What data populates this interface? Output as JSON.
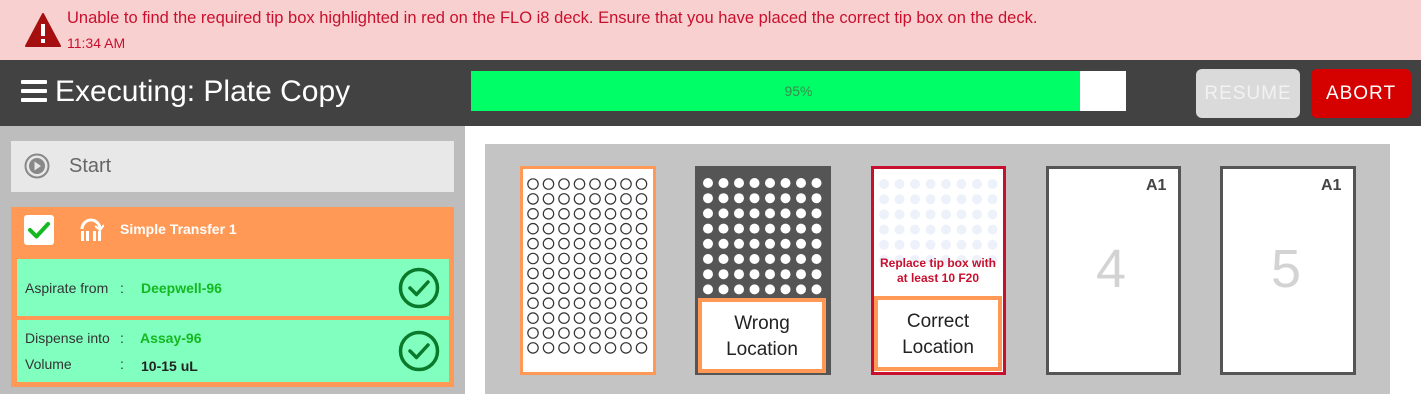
{
  "alert": {
    "message": "Unable to find the required tip box highlighted in red on the FLO i8 deck. Ensure that you have placed the correct tip box on the deck.",
    "time": "11:34 AM",
    "icon": "warning-icon",
    "color": "#c8102e"
  },
  "header": {
    "title": "Executing: Plate Copy",
    "progress_label": "95%",
    "progress_value": 0.93,
    "resume_label": "RESUME",
    "abort_label": "ABORT",
    "progress_color": "#00ff66",
    "abort_color": "#d50000"
  },
  "sidebar": {
    "start_label": "Start",
    "step": {
      "title": "Simple Transfer 1",
      "aspirate_label": "Aspirate from",
      "aspirate_colon": ":",
      "aspirate_value": "Deepwell-96",
      "dispense_label": "Dispense into",
      "dispense_colon": ":",
      "dispense_value": "Assay-96",
      "volume_label": "Volume",
      "volume_colon": ":",
      "volume_value": "10-15 uL"
    }
  },
  "deck": {
    "wrong_location": "Wrong Location",
    "correct_location": "Correct Location",
    "replace_message": "Replace tip box with at least 10 F20",
    "slot4_corner": "A1",
    "slot4_number": "4",
    "slot5_corner": "A1",
    "slot5_number": "5"
  }
}
